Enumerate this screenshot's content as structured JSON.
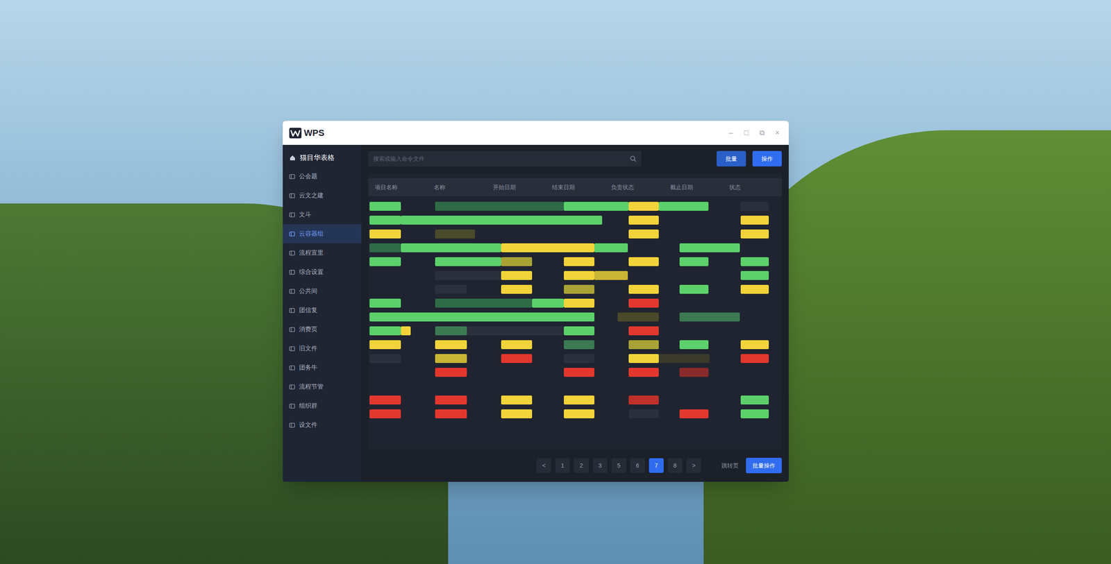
{
  "window": {
    "title": "WPS",
    "controls": [
      "–",
      "□",
      "⧉",
      "×"
    ]
  },
  "sidebar": {
    "header": "猫目华表格",
    "items": [
      {
        "label": "公会题",
        "selected": false
      },
      {
        "label": "云文之建",
        "selected": false
      },
      {
        "label": "文斗",
        "selected": false
      },
      {
        "label": "云容器组",
        "selected": true
      },
      {
        "label": "流程宣里",
        "selected": false
      },
      {
        "label": "综合设置",
        "selected": false
      },
      {
        "label": "公共间",
        "selected": false
      },
      {
        "label": "团信复",
        "selected": false
      },
      {
        "label": "消费页",
        "selected": false
      },
      {
        "label": "旧文件",
        "selected": false
      },
      {
        "label": "团务牛",
        "selected": false
      },
      {
        "label": "流程节管",
        "selected": false
      },
      {
        "label": "组织群",
        "selected": false
      },
      {
        "label": "设文件",
        "selected": false
      }
    ]
  },
  "search": {
    "placeholder": "搜索或输入命令文件"
  },
  "toolbar": {
    "buttons": [
      "批量",
      "操作"
    ]
  },
  "table": {
    "columns": [
      "项目名称",
      "名称",
      "开始日期",
      "结束日期",
      "负责状态",
      "截止日期",
      "状态"
    ],
    "rows": [
      {
        "bars": [
          {
            "start": 0.02,
            "end": 0.55,
            "color": "#5cd16b"
          },
          {
            "start": 1.13,
            "end": 3.31,
            "color": "#2e6b45"
          },
          {
            "start": 3.31,
            "end": 4.41,
            "color": "#5cd16b"
          },
          {
            "start": 4.41,
            "end": 4.92,
            "color": "#f2d43a"
          },
          {
            "start": 4.92,
            "end": 5.76,
            "color": "#5cd16b"
          },
          {
            "start": 6.3,
            "end": 6.78,
            "color": "#2a303c"
          }
        ]
      },
      {
        "bars": [
          {
            "start": 0.02,
            "end": 0.55,
            "color": "#5cd16b"
          },
          {
            "start": 0.55,
            "end": 3.96,
            "color": "#5cd16b"
          },
          {
            "start": 4.41,
            "end": 4.92,
            "color": "#f2d43a"
          },
          {
            "start": 6.3,
            "end": 6.78,
            "color": "#f2d43a"
          }
        ]
      },
      {
        "bars": [
          {
            "start": 0.02,
            "end": 0.55,
            "color": "#f2d43a"
          },
          {
            "start": 1.13,
            "end": 1.81,
            "color": "#4a4a2a"
          },
          {
            "start": 4.41,
            "end": 4.92,
            "color": "#f2d43a"
          },
          {
            "start": 6.3,
            "end": 6.78,
            "color": "#f2d43a"
          }
        ]
      },
      {
        "bars": [
          {
            "start": 0.02,
            "end": 0.55,
            "color": "#2e6b45"
          },
          {
            "start": 0.55,
            "end": 2.25,
            "color": "#5cd16b"
          },
          {
            "start": 2.25,
            "end": 3.83,
            "color": "#f2d43a"
          },
          {
            "start": 3.83,
            "end": 4.39,
            "color": "#5cd16b"
          },
          {
            "start": 5.27,
            "end": 6.29,
            "color": "#5cd16b"
          }
        ]
      },
      {
        "bars": [
          {
            "start": 0.02,
            "end": 0.55,
            "color": "#5cd16b"
          },
          {
            "start": 1.13,
            "end": 2.25,
            "color": "#5cd16b"
          },
          {
            "start": 2.25,
            "end": 2.77,
            "color": "#a9a235"
          },
          {
            "start": 3.31,
            "end": 3.83,
            "color": "#f2d43a"
          },
          {
            "start": 4.41,
            "end": 4.92,
            "color": "#f2d43a"
          },
          {
            "start": 5.27,
            "end": 5.76,
            "color": "#5cd16b"
          },
          {
            "start": 6.3,
            "end": 6.78,
            "color": "#5cd16b"
          }
        ]
      },
      {
        "bars": [
          {
            "start": 1.13,
            "end": 2.25,
            "color": "#2a303c"
          },
          {
            "start": 2.25,
            "end": 2.77,
            "color": "#f2d43a"
          },
          {
            "start": 3.31,
            "end": 3.83,
            "color": "#f2d43a"
          },
          {
            "start": 3.83,
            "end": 4.39,
            "color": "#c9b635"
          },
          {
            "start": 6.3,
            "end": 6.78,
            "color": "#5cd16b"
          }
        ]
      },
      {
        "bars": [
          {
            "start": 1.13,
            "end": 1.67,
            "color": "#2a303c"
          },
          {
            "start": 2.25,
            "end": 2.77,
            "color": "#f2d43a"
          },
          {
            "start": 3.31,
            "end": 3.83,
            "color": "#a9a235"
          },
          {
            "start": 4.41,
            "end": 4.92,
            "color": "#f2d43a"
          },
          {
            "start": 5.27,
            "end": 5.76,
            "color": "#5cd16b"
          },
          {
            "start": 6.3,
            "end": 6.78,
            "color": "#f2d43a"
          }
        ]
      },
      {
        "bars": [
          {
            "start": 0.02,
            "end": 0.55,
            "color": "#5cd16b"
          },
          {
            "start": 1.13,
            "end": 2.77,
            "color": "#2e6b45"
          },
          {
            "start": 2.77,
            "end": 3.31,
            "color": "#5cd16b"
          },
          {
            "start": 3.31,
            "end": 3.83,
            "color": "#f2d43a"
          },
          {
            "start": 4.41,
            "end": 4.92,
            "color": "#e3372e"
          }
        ]
      },
      {
        "bars": [
          {
            "start": 0.02,
            "end": 3.83,
            "color": "#5cd16b"
          },
          {
            "start": 4.22,
            "end": 4.92,
            "color": "#4a4a2a"
          },
          {
            "start": 5.27,
            "end": 6.29,
            "color": "#3c7a52"
          }
        ]
      },
      {
        "bars": [
          {
            "start": 0.02,
            "end": 0.55,
            "color": "#5cd16b"
          },
          {
            "start": 0.55,
            "end": 0.72,
            "color": "#f2d43a"
          },
          {
            "start": 1.13,
            "end": 1.67,
            "color": "#3c7a52"
          },
          {
            "start": 1.67,
            "end": 3.31,
            "color": "#2a303c"
          },
          {
            "start": 3.31,
            "end": 3.83,
            "color": "#5cd16b"
          },
          {
            "start": 4.41,
            "end": 4.92,
            "color": "#e3372e"
          }
        ]
      },
      {
        "bars": [
          {
            "start": 0.02,
            "end": 0.55,
            "color": "#f2d43a"
          },
          {
            "start": 1.13,
            "end": 1.67,
            "color": "#f2d43a"
          },
          {
            "start": 2.25,
            "end": 2.77,
            "color": "#f2d43a"
          },
          {
            "start": 3.31,
            "end": 3.83,
            "color": "#3c7a52"
          },
          {
            "start": 4.41,
            "end": 4.92,
            "color": "#a9a235"
          },
          {
            "start": 5.27,
            "end": 5.76,
            "color": "#5cd16b"
          },
          {
            "start": 6.3,
            "end": 6.78,
            "color": "#f2d43a"
          }
        ]
      },
      {
        "bars": [
          {
            "start": 0.02,
            "end": 0.55,
            "color": "#2a303c"
          },
          {
            "start": 1.13,
            "end": 1.67,
            "color": "#c9b635"
          },
          {
            "start": 2.25,
            "end": 2.77,
            "color": "#e3372e"
          },
          {
            "start": 3.31,
            "end": 3.83,
            "color": "#2a303c"
          },
          {
            "start": 4.41,
            "end": 4.92,
            "color": "#f2d43a"
          },
          {
            "start": 4.92,
            "end": 5.78,
            "color": "#3a3a2a"
          },
          {
            "start": 6.3,
            "end": 6.78,
            "color": "#e3372e"
          }
        ]
      },
      {
        "bars": [
          {
            "start": 1.13,
            "end": 1.67,
            "color": "#e3372e"
          },
          {
            "start": 3.31,
            "end": 3.83,
            "color": "#e3372e"
          },
          {
            "start": 4.41,
            "end": 4.92,
            "color": "#e3372e"
          },
          {
            "start": 5.27,
            "end": 5.76,
            "color": "#8a2a2a"
          }
        ]
      },
      {
        "bars": []
      },
      {
        "bars": [
          {
            "start": 0.02,
            "end": 0.55,
            "color": "#e3372e"
          },
          {
            "start": 1.13,
            "end": 1.67,
            "color": "#e3372e"
          },
          {
            "start": 2.25,
            "end": 2.77,
            "color": "#f2d43a"
          },
          {
            "start": 3.31,
            "end": 3.83,
            "color": "#f2d43a"
          },
          {
            "start": 4.41,
            "end": 4.92,
            "color": "#c0302a"
          },
          {
            "start": 6.3,
            "end": 6.78,
            "color": "#5cd16b"
          }
        ]
      },
      {
        "bars": [
          {
            "start": 0.02,
            "end": 0.55,
            "color": "#e3372e"
          },
          {
            "start": 1.13,
            "end": 1.67,
            "color": "#e3372e"
          },
          {
            "start": 2.25,
            "end": 2.77,
            "color": "#f2d43a"
          },
          {
            "start": 3.31,
            "end": 3.83,
            "color": "#f2d43a"
          },
          {
            "start": 4.41,
            "end": 4.92,
            "color": "#2a303c"
          },
          {
            "start": 5.27,
            "end": 5.76,
            "color": "#e3372e"
          },
          {
            "start": 6.3,
            "end": 6.78,
            "color": "#5cd16b"
          }
        ]
      }
    ]
  },
  "pagination": {
    "pages": [
      {
        "label": "<",
        "selected": false
      },
      {
        "label": "1",
        "selected": false
      },
      {
        "label": "2",
        "selected": false
      },
      {
        "label": "3",
        "selected": false
      },
      {
        "label": "5",
        "selected": false
      },
      {
        "label": "6",
        "selected": false
      },
      {
        "label": "7",
        "selected": true
      },
      {
        "label": "8",
        "selected": false
      },
      {
        "label": ">",
        "selected": false
      }
    ],
    "jump_label": "跳转页",
    "action": "批量操作"
  }
}
